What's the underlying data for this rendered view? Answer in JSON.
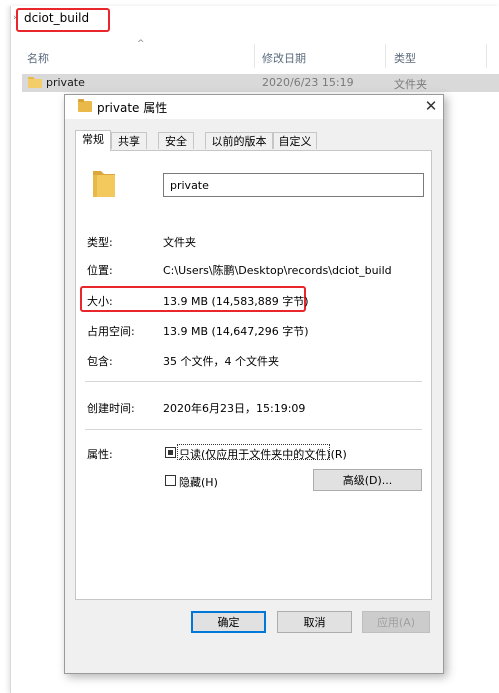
{
  "explorer": {
    "address": "dciot_build",
    "columns": {
      "name": "名称",
      "modified": "修改日期",
      "type": "类型"
    },
    "rows": [
      {
        "name": "private",
        "modified": "2020/6/23 15:19",
        "type": "文件夹"
      }
    ]
  },
  "dialog": {
    "title": "private 属性",
    "close": "✕",
    "tabs": [
      "常规",
      "共享",
      "安全",
      "以前的版本",
      "自定义"
    ],
    "folder_name": "private",
    "props": {
      "type": {
        "label": "类型:",
        "value": "文件夹"
      },
      "location": {
        "label": "位置:",
        "value": "C:\\Users\\陈鹏\\Desktop\\records\\dciot_build"
      },
      "size": {
        "label": "大小:",
        "value": "13.9 MB (14,583,889 字节)"
      },
      "disk": {
        "label": "占用空间:",
        "value": "13.9 MB (14,647,296 字节)"
      },
      "contains": {
        "label": "包含:",
        "value": "35 个文件，4 个文件夹"
      },
      "created": {
        "label": "创建时间:",
        "value": "2020年6月23日，15:19:09"
      },
      "attrs": {
        "label": "属性:"
      }
    },
    "attributes": {
      "readonly": "只读(仅应用于文件夹中的文件)(R)",
      "hidden": "隐藏(H)",
      "advanced": "高级(D)..."
    },
    "buttons": {
      "ok": "确定",
      "cancel": "取消",
      "apply": "应用(A)"
    }
  },
  "colors": {
    "highlight": "#e8262b",
    "folder": "#e9b949",
    "accent": "#0078d7"
  }
}
